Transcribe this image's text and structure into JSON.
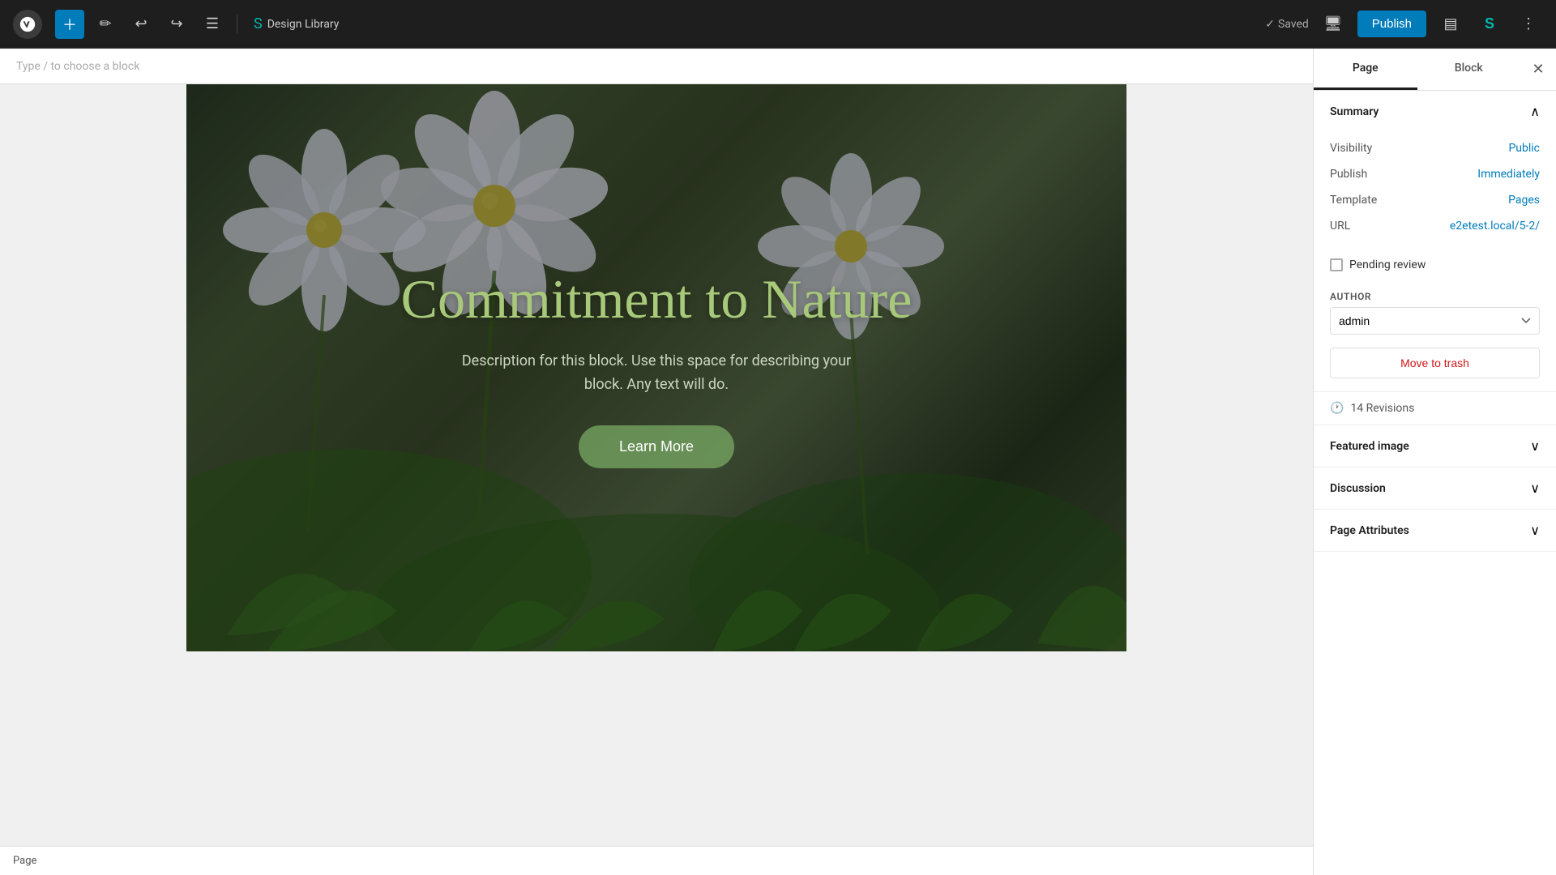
{
  "toolbar": {
    "add_label": "+",
    "design_library_label": "Design Library",
    "saved_label": "Saved",
    "publish_label": "Publish",
    "block_hint": "Type / to choose a block"
  },
  "sidebar": {
    "tab_page": "Page",
    "tab_block": "Block",
    "summary_title": "Summary",
    "visibility_label": "Visibility",
    "visibility_value": "Public",
    "publish_label": "Publish",
    "publish_value": "Immediately",
    "template_label": "Template",
    "template_value": "Pages",
    "url_label": "URL",
    "url_value": "e2etest.local/5-2/",
    "pending_review_label": "Pending review",
    "author_label": "AUTHOR",
    "author_value": "admin",
    "move_to_trash_label": "Move to trash",
    "revisions_label": "14 Revisions",
    "featured_image_label": "Featured image",
    "discussion_label": "Discussion",
    "page_attributes_label": "Page Attributes"
  },
  "hero": {
    "title": "Commitment to Nature",
    "description": "Description for this block. Use this space for describing your block. Any text will do.",
    "button_label": "Learn More"
  },
  "status_bar": {
    "label": "Page"
  }
}
